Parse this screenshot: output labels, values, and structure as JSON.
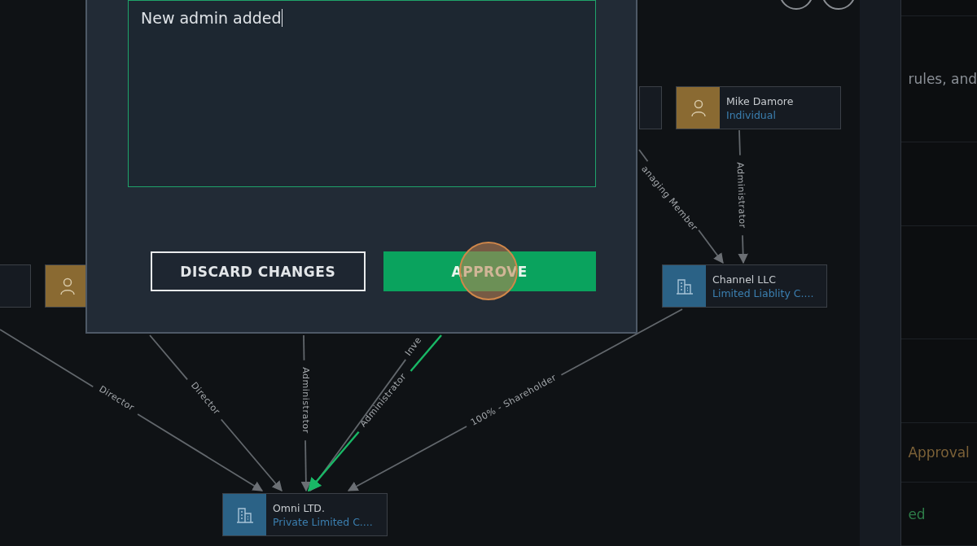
{
  "canvas": {
    "nodes": [
      {
        "kind": "blank"
      },
      {
        "kind": "individual"
      },
      {
        "kind": "blank"
      },
      {
        "kind": "individual",
        "name": "Mike Damore",
        "type": "Individual"
      },
      {
        "kind": "company",
        "name": "Channel LLC",
        "type": "Limited Liablity C...."
      },
      {
        "kind": "company",
        "name": "Omni LTD.",
        "type": "Private Limited C...."
      }
    ],
    "edges": [
      {
        "label": "Director",
        "highlighted": false
      },
      {
        "label": "Director",
        "highlighted": false
      },
      {
        "label": "Administrator",
        "highlighted": false
      },
      {
        "label": "Inve",
        "highlighted": false
      },
      {
        "label": "Administrator",
        "highlighted": true
      },
      {
        "label": "100% - Shareholder",
        "highlighted": false
      },
      {
        "label": "anaging Member",
        "highlighted": false
      },
      {
        "label": "Administrator",
        "highlighted": false
      }
    ]
  },
  "side_panel": {
    "rows": [
      {
        "text": ""
      },
      {
        "text": "rules, and",
        "kind": "plain"
      },
      {
        "text": ""
      },
      {
        "text": ""
      },
      {
        "text": ""
      },
      {
        "text": "Approval",
        "kind": "pending"
      },
      {
        "text": "ed",
        "kind": "approved"
      }
    ]
  },
  "modal": {
    "note": "New admin added",
    "buttons": [
      {
        "label": "DISCARD CHANGES",
        "kind": "secondary"
      },
      {
        "label": "APPROVE",
        "kind": "primary"
      }
    ]
  }
}
